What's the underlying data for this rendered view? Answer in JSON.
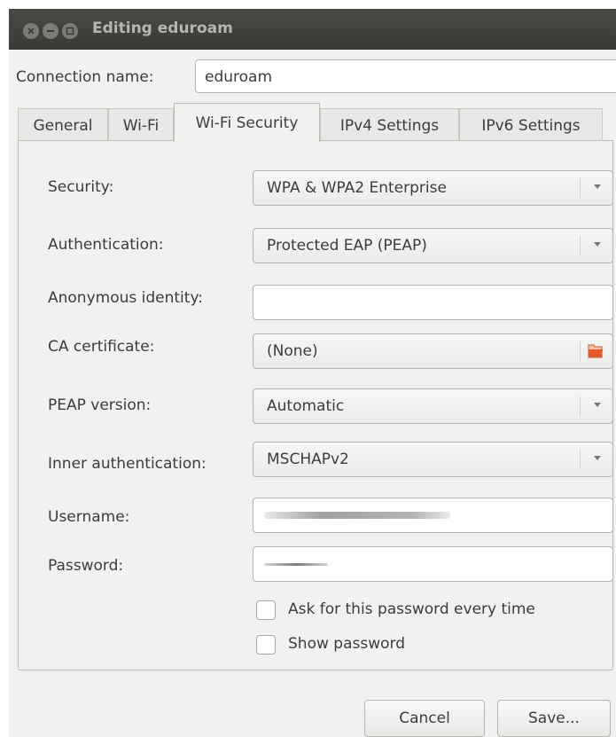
{
  "window": {
    "title": "Editing eduroam"
  },
  "connection": {
    "label": "Connection name:",
    "value": "eduroam"
  },
  "tabs": [
    {
      "label": "General"
    },
    {
      "label": "Wi-Fi"
    },
    {
      "label": "Wi-Fi Security",
      "active": true
    },
    {
      "label": "IPv4 Settings"
    },
    {
      "label": "IPv6 Settings"
    }
  ],
  "security": {
    "security_label": "Security:",
    "security_value": "WPA & WPA2 Enterprise",
    "authentication_label": "Authentication:",
    "authentication_value": "Protected EAP (PEAP)",
    "anonymous_identity_label": "Anonymous identity:",
    "anonymous_identity_value": "",
    "ca_certificate_label": "CA certificate:",
    "ca_certificate_value": "(None)",
    "peap_version_label": "PEAP version:",
    "peap_version_value": "Automatic",
    "inner_auth_label": "Inner authentication:",
    "inner_auth_value": "MSCHAPv2",
    "username_label": "Username:",
    "password_label": "Password:",
    "ask_password_label": "Ask for this password every time",
    "ask_password_checked": false,
    "show_password_label": "Show password",
    "show_password_checked": false
  },
  "buttons": {
    "cancel": "Cancel",
    "save": "Save..."
  },
  "icons": {
    "close": "close-icon",
    "minimize": "minimize-icon",
    "maximize": "maximize-icon",
    "file_open": "folder-open-icon",
    "dropdown": "chevron-down-icon"
  },
  "colors": {
    "titlebar": "#3f3e3a",
    "window_bg": "#f2f1f0",
    "file_icon": "#e2592a"
  }
}
